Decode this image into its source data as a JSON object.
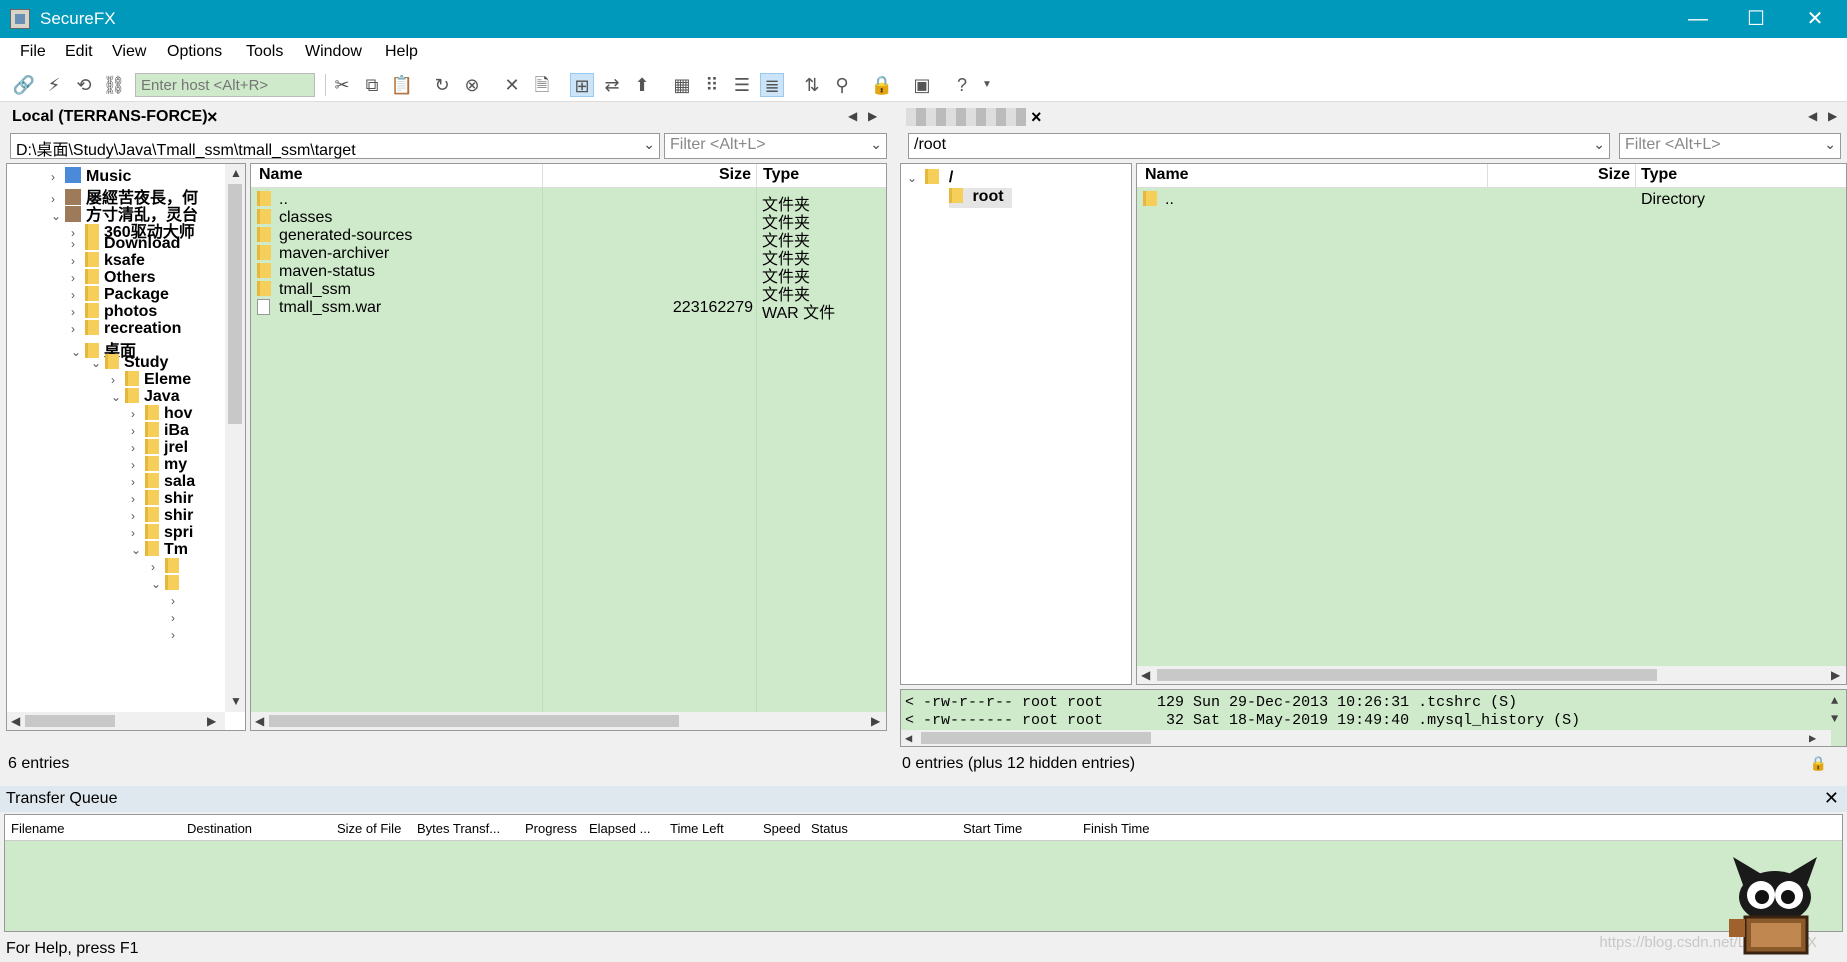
{
  "window": {
    "title": "SecureFX",
    "minimize": "—",
    "maximize": "☐",
    "close": "✕"
  },
  "menu": [
    "File",
    "Edit",
    "View",
    "Options",
    "Tools",
    "Window",
    "Help"
  ],
  "toolbar": {
    "host_placeholder": "Enter host <Alt+R>"
  },
  "local": {
    "tab_label": "Local (TERRANS-FORCE)",
    "path": "D:\\桌面\\Study\\Java\\Tmall_ssm\\tmall_ssm\\target",
    "filter_placeholder": "Filter <Alt+L>",
    "tree": [
      {
        "label": "Music",
        "expander": ">",
        "icon": "music-icon"
      },
      {
        "label": "屡經苦夜長，何",
        "expander": ">",
        "icon": "image-icon"
      },
      {
        "label": "方寸清乱，灵台",
        "expander": "v",
        "icon": "image-icon"
      },
      {
        "label": "360驱动大师",
        "expander": ">",
        "icon": "folder-icon"
      },
      {
        "label": "Download",
        "expander": ">",
        "icon": "folder-icon"
      },
      {
        "label": "ksafe",
        "expander": ">",
        "icon": "folder-icon"
      },
      {
        "label": "Others",
        "expander": ">",
        "icon": "folder-icon"
      },
      {
        "label": "Package",
        "expander": ">",
        "icon": "folder-icon"
      },
      {
        "label": "photos",
        "expander": ">",
        "icon": "folder-icon"
      },
      {
        "label": "recreation",
        "expander": ">",
        "icon": "folder-icon"
      },
      {
        "label": "桌面",
        "expander": "v",
        "icon": "folder-icon"
      },
      {
        "label": "Study",
        "expander": "v",
        "icon": "folder-icon"
      },
      {
        "label": "Eleme",
        "expander": ">",
        "icon": "folder-icon"
      },
      {
        "label": "Java",
        "expander": "v",
        "icon": "folder-icon"
      },
      {
        "label": "hov",
        "expander": ">",
        "icon": "folder-icon"
      },
      {
        "label": "iBa",
        "expander": ">",
        "icon": "folder-icon"
      },
      {
        "label": "jrel",
        "expander": ">",
        "icon": "folder-icon"
      },
      {
        "label": "my",
        "expander": ">",
        "icon": "folder-icon"
      },
      {
        "label": "sala",
        "expander": ">",
        "icon": "folder-icon"
      },
      {
        "label": "shir",
        "expander": ">",
        "icon": "folder-icon"
      },
      {
        "label": "shir",
        "expander": ">",
        "icon": "folder-icon"
      },
      {
        "label": "spri",
        "expander": ">",
        "icon": "folder-icon"
      },
      {
        "label": "Tm",
        "expander": "v",
        "icon": "folder-icon"
      },
      {
        "label": "",
        "expander": ">",
        "icon": "folder-icon"
      },
      {
        "label": "",
        "expander": "v",
        "icon": "folder-icon"
      },
      {
        "label": "",
        "expander": ">",
        "icon": ""
      },
      {
        "label": "",
        "expander": ">",
        "icon": ""
      },
      {
        "label": "",
        "expander": ">",
        "icon": ""
      }
    ],
    "columns": {
      "name": "Name",
      "size": "Size",
      "type": "Type"
    },
    "files": [
      {
        "name": "..",
        "size": "",
        "type": "文件夹",
        "icon": "folder-icon"
      },
      {
        "name": "classes",
        "size": "",
        "type": "文件夹",
        "icon": "folder-icon"
      },
      {
        "name": "generated-sources",
        "size": "",
        "type": "文件夹",
        "icon": "folder-icon"
      },
      {
        "name": "maven-archiver",
        "size": "",
        "type": "文件夹",
        "icon": "folder-icon"
      },
      {
        "name": "maven-status",
        "size": "",
        "type": "文件夹",
        "icon": "folder-icon"
      },
      {
        "name": "tmall_ssm",
        "size": "",
        "type": "文件夹",
        "icon": "folder-icon"
      },
      {
        "name": "tmall_ssm.war",
        "size": "223162279",
        "type": "WAR 文件",
        "icon": "file-icon"
      }
    ],
    "status": "6 entries"
  },
  "remote": {
    "path": "/root",
    "filter_placeholder": "Filter <Alt+L>",
    "tree": [
      {
        "label": "/",
        "expander": "v"
      },
      {
        "label": "root",
        "expander": ""
      }
    ],
    "columns": {
      "name": "Name",
      "size": "Size",
      "type": "Type"
    },
    "files": [
      {
        "name": "..",
        "size": "",
        "type": "Directory"
      }
    ],
    "log": [
      "< -rw-r--r-- root root      129 Sun 29-Dec-2013 10:26:31 .tcshrc (S)",
      "< -rw------- root root       32 Sat 18-May-2019 19:49:40 .mysql_history (S)"
    ],
    "status": "0 entries (plus 12 hidden entries)"
  },
  "transfer_queue": {
    "title": "Transfer Queue",
    "columns": [
      "Filename",
      "Destination",
      "Size of File",
      "Bytes Transf...",
      "Progress",
      "Elapsed ...",
      "Time Left",
      "Speed",
      "Status",
      "Start Time",
      "Finish Time"
    ]
  },
  "statusbar": "For Help, press F1",
  "watermark": "https://blog.csdn.net/LeoChen_X"
}
